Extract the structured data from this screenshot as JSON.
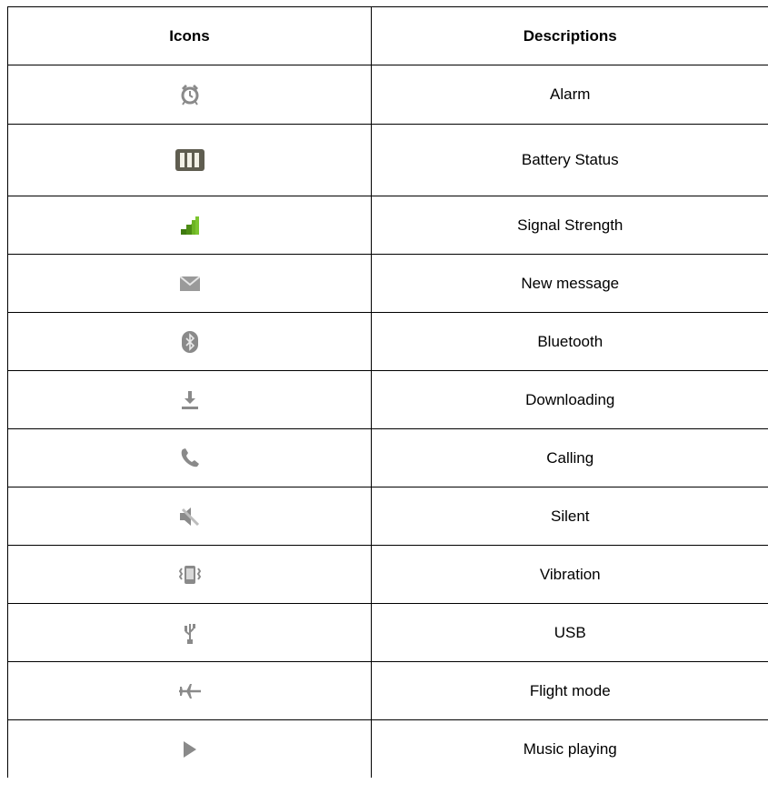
{
  "header": {
    "icons": "Icons",
    "descriptions": "Descriptions"
  },
  "rows": [
    {
      "icon": "alarm-clock-icon",
      "label": "Alarm"
    },
    {
      "icon": "battery-icon",
      "label": "Battery Status"
    },
    {
      "icon": "signal-strength-icon",
      "label": "Signal Strength"
    },
    {
      "icon": "envelope-icon",
      "label": "New message"
    },
    {
      "icon": "bluetooth-icon",
      "label": "Bluetooth"
    },
    {
      "icon": "download-icon",
      "label": "Downloading"
    },
    {
      "icon": "phone-icon",
      "label": "Calling"
    },
    {
      "icon": "muted-speaker-icon",
      "label": "Silent"
    },
    {
      "icon": "vibrate-icon",
      "label": "Vibration"
    },
    {
      "icon": "usb-icon",
      "label": "USB"
    },
    {
      "icon": "airplane-icon",
      "label": "Flight mode"
    },
    {
      "icon": "play-icon",
      "label": "Music playing"
    }
  ],
  "colors": {
    "border": "#000000",
    "signal_green": "#5a9e1a",
    "icon_gray": "#8a8a8a",
    "battery_dark": "#5f5d50"
  }
}
